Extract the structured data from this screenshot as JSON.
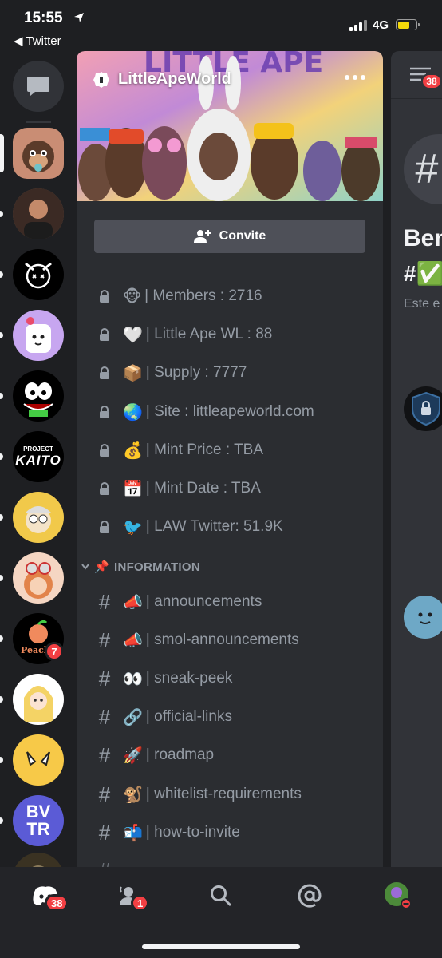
{
  "status_bar": {
    "time": "15:55",
    "back_app": "Twitter",
    "network": "4G",
    "battery_color": "#f5d90a"
  },
  "server_rail": {
    "dm_icon": "chat-bubble-icon",
    "mention_badge": "7"
  },
  "banner": {
    "server_name": "LittleApeWorld",
    "more_icon": "ellipsis-icon"
  },
  "invite": {
    "label": "Convite",
    "icon": "add-person-icon"
  },
  "stat_channels": [
    {
      "emoji": "🐵",
      "label": "| Members : 2716"
    },
    {
      "emoji": "🤍",
      "label": "| Little Ape WL : 88"
    },
    {
      "emoji": "📦",
      "label": "| Supply : 7777"
    },
    {
      "emoji": "🌏",
      "label": "| Site : littleapeworld.com"
    },
    {
      "emoji": "💰",
      "label": "| Mint Price : TBA"
    },
    {
      "emoji": "📅",
      "label": "| Mint Date : TBA"
    },
    {
      "emoji": "🐦",
      "label": "| LAW Twitter: 51.9K"
    }
  ],
  "category": {
    "emoji": "📌",
    "name": "INFORMATION"
  },
  "text_channels": [
    {
      "emoji": "📣",
      "label": "| announcements"
    },
    {
      "emoji": "📣",
      "label": "| smol-announcements"
    },
    {
      "emoji": "👀",
      "label": "| sneak-peek"
    },
    {
      "emoji": "🔗",
      "label": "| official-links"
    },
    {
      "emoji": "🚀",
      "label": "| roadmap"
    },
    {
      "emoji": "🐒",
      "label": "| whitelist-requirements"
    },
    {
      "emoji": "📬",
      "label": "| how-to-invite"
    }
  ],
  "peek": {
    "members_badge": "38",
    "title_line1": "Ben",
    "title_line2": "#✅",
    "subtitle": "Este e"
  },
  "bottom_nav": {
    "home_badge": "38",
    "friends_badge": "1"
  },
  "colors": {
    "accent_red": "#f23f43",
    "panel_bg": "#2b2d31",
    "rail_bg": "#1e1f22"
  }
}
